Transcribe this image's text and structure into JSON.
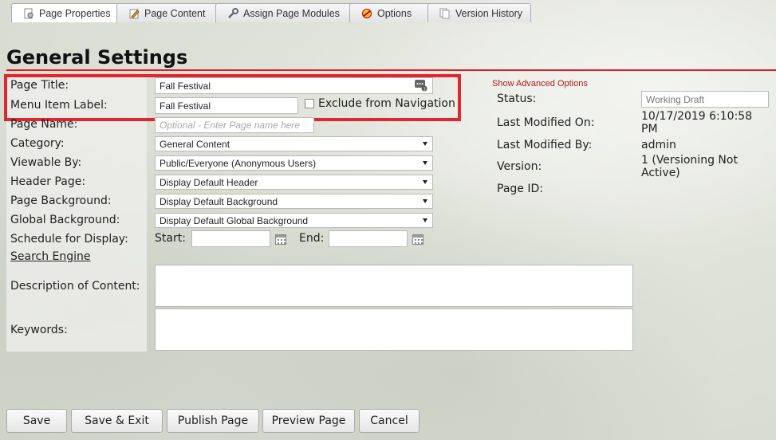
{
  "tabs": [
    {
      "label": "Page Properties",
      "icon": "page-properties-icon",
      "active": true
    },
    {
      "label": "Page Content",
      "icon": "edit-pencil-icon",
      "active": false
    },
    {
      "label": "Assign Page Modules",
      "icon": "wrench-icon",
      "active": false
    },
    {
      "label": "Options",
      "icon": "options-icon",
      "active": false
    },
    {
      "label": "Version History",
      "icon": "version-history-icon",
      "active": false
    }
  ],
  "page_title": "General Settings",
  "highlight_color": "#e0262f",
  "form": {
    "page_title_label": "Page Title:",
    "page_title_value": "Fall Festival",
    "menu_label_label": "Menu Item Label:",
    "menu_label_value": "Fall Festival",
    "exclude_nav_label": "Exclude from Navigation",
    "exclude_nav_checked": false,
    "page_name_label": "Page Name:",
    "page_name_placeholder": "Optional - Enter Page name here",
    "category_label": "Category:",
    "category_value": "General Content",
    "viewable_label": "Viewable By:",
    "viewable_value": "Public/Everyone (Anonymous Users)",
    "header_label": "Header Page:",
    "header_value": "Display Default Header",
    "page_bg_label": "Page Background:",
    "page_bg_value": "Display Default Background",
    "global_bg_label": "Global Background:",
    "global_bg_value": "Display Default Global Background",
    "schedule_label": "Schedule for Display:",
    "start_label": "Start:",
    "end_label": "End:",
    "search_engine_label": "Search Engine",
    "description_label": "Description of Content:",
    "keywords_label": "Keywords:"
  },
  "advanced": {
    "link": "Show Advanced Options",
    "status_label": "Status:",
    "status_value": "Working Draft",
    "modified_on_label": "Last Modified On:",
    "modified_on_line1": "10/17/2019 6:10:58",
    "modified_on_line2": "PM",
    "modified_by_label": "Last Modified By:",
    "modified_by_value": "admin",
    "version_label": "Version:",
    "version_line1": "1 (Versioning Not",
    "version_line2": "Active)",
    "page_id_label": "Page ID:"
  },
  "buttons": {
    "save": "Save",
    "save_exit": "Save & Exit",
    "publish": "Publish Page",
    "preview": "Preview Page",
    "cancel": "Cancel"
  }
}
